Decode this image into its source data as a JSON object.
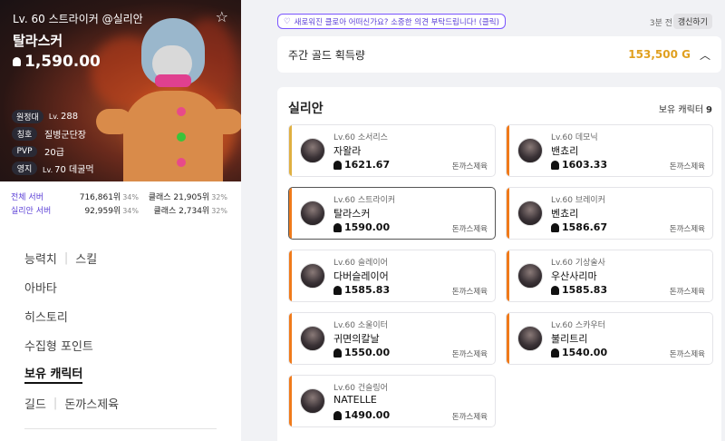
{
  "hero": {
    "level_line": "Lv. 60 스트라이커 @실리안",
    "name": "탈라스커",
    "item_level": "1,590.00",
    "info": [
      {
        "label": "원정대",
        "prefix": "Lv.",
        "value": "288"
      },
      {
        "label": "칭호",
        "prefix": "",
        "value": "질병군단장"
      },
      {
        "label": "PVP",
        "prefix": "",
        "value": "20급"
      },
      {
        "label": "영지",
        "prefix": "Lv.",
        "value": "70 데굴먹"
      }
    ]
  },
  "ranking": [
    {
      "label": "전체 서버",
      "rank": "716,861위",
      "pct": "34%",
      "class_rank": "클래스 21,905위",
      "class_pct": "32%"
    },
    {
      "label": "실리안 서버",
      "rank": "92,959위",
      "pct": "34%",
      "class_rank": "클래스 2,734위",
      "class_pct": "32%"
    }
  ],
  "menu": {
    "ability": "능력치",
    "skill": "스킬",
    "avatar": "아바타",
    "history": "히스토리",
    "collectible": "수집형 포인트",
    "characters": "보유 캐릭터",
    "guild": "길드",
    "guild_name": "돈까스제육"
  },
  "top": {
    "feedback": "새로워진 클로아 어떠신가요? 소중한 의견 부탁드립니다! (클릭)",
    "updated": "3분 전",
    "refresh": "갱신하기"
  },
  "gold": {
    "label": "주간 골드 획득량",
    "amount": "153,500 G"
  },
  "server": {
    "name": "실리안",
    "owned_label": "보유 캐릭터",
    "owned_count": "9"
  },
  "colors": {
    "accent": "#5b3fd6",
    "gold": "#e0a020",
    "bar_orange": "#f07a1a",
    "bar_yellow": "#e0b040"
  },
  "characters": [
    {
      "cls": "Lv.60 소서리스",
      "name": "자왈라",
      "il": "1621.67",
      "guild": "돈까스제육",
      "bar": "#e0b040"
    },
    {
      "cls": "Lv.60 데모닉",
      "name": "밴쵸리",
      "il": "1603.33",
      "guild": "돈까스제육",
      "bar": "#f07a1a"
    },
    {
      "cls": "Lv.60 스트라이커",
      "name": "탈라스커",
      "il": "1590.00",
      "guild": "돈까스제육",
      "bar": "#f07a1a"
    },
    {
      "cls": "Lv.60 브레이커",
      "name": "벤쵸리",
      "il": "1586.67",
      "guild": "돈까스제육",
      "bar": "#f07a1a"
    },
    {
      "cls": "Lv.60 슬레이어",
      "name": "다버슬레이어",
      "il": "1585.83",
      "guild": "돈까스제육",
      "bar": "#f07a1a"
    },
    {
      "cls": "Lv.60 기상술사",
      "name": "우산사리마",
      "il": "1585.83",
      "guild": "돈까스제육",
      "bar": "#f07a1a"
    },
    {
      "cls": "Lv.60 소울이터",
      "name": "귀면의칼날",
      "il": "1550.00",
      "guild": "돈까스제육",
      "bar": "#f07a1a"
    },
    {
      "cls": "Lv.60 스카우터",
      "name": "불리트리",
      "il": "1540.00",
      "guild": "돈까스제육",
      "bar": "#f07a1a"
    },
    {
      "cls": "Lv.60 건슬링어",
      "name": "NATELLE",
      "il": "1490.00",
      "guild": "돈까스제육",
      "bar": "#f07a1a"
    }
  ]
}
